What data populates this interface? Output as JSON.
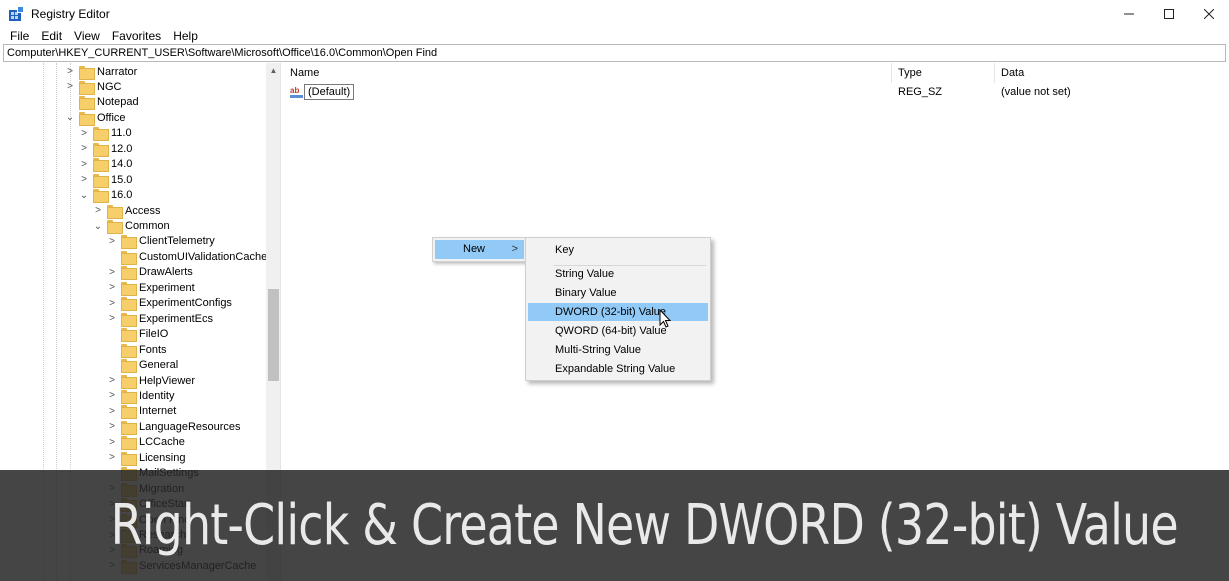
{
  "window": {
    "title": "Registry Editor",
    "minimize_icon": "minimize-icon",
    "maximize_icon": "maximize-icon",
    "close_icon": "close-icon"
  },
  "menu": [
    "File",
    "Edit",
    "View",
    "Favorites",
    "Help"
  ],
  "address": "Computer\\HKEY_CURRENT_USER\\Software\\Microsoft\\Office\\16.0\\Common\\Open Find",
  "tree": [
    {
      "label": "Narrator",
      "chevron": ">"
    },
    {
      "label": "NGC",
      "chevron": ">"
    },
    {
      "label": "Notepad",
      "chevron": ""
    },
    {
      "label": "Office",
      "chevron": "v"
    },
    {
      "label": "11.0",
      "chevron": ">"
    },
    {
      "label": "12.0",
      "chevron": ">"
    },
    {
      "label": "14.0",
      "chevron": ">"
    },
    {
      "label": "15.0",
      "chevron": ">"
    },
    {
      "label": "16.0",
      "chevron": "v"
    },
    {
      "label": "Access",
      "chevron": ">"
    },
    {
      "label": "Common",
      "chevron": "v"
    },
    {
      "label": "ClientTelemetry",
      "chevron": ">"
    },
    {
      "label": "CustomUIValidationCache",
      "chevron": ""
    },
    {
      "label": "DrawAlerts",
      "chevron": ">"
    },
    {
      "label": "Experiment",
      "chevron": ">"
    },
    {
      "label": "ExperimentConfigs",
      "chevron": ">"
    },
    {
      "label": "ExperimentEcs",
      "chevron": ">"
    },
    {
      "label": "FileIO",
      "chevron": ""
    },
    {
      "label": "Fonts",
      "chevron": ""
    },
    {
      "label": "General",
      "chevron": ""
    },
    {
      "label": "HelpViewer",
      "chevron": ">"
    },
    {
      "label": "Identity",
      "chevron": ">"
    },
    {
      "label": "Internet",
      "chevron": ">"
    },
    {
      "label": "LanguageResources",
      "chevron": ">"
    },
    {
      "label": "LCCache",
      "chevron": ">"
    },
    {
      "label": "Licensing",
      "chevron": ">"
    },
    {
      "label": "MailSettings",
      "chevron": ""
    },
    {
      "label": "Migration",
      "chevron": ">"
    },
    {
      "label": "OfficeStart",
      "chevron": ">"
    },
    {
      "label": "Open Find",
      "chevron": ">"
    },
    {
      "label": "Research",
      "chevron": ">"
    },
    {
      "label": "Roaming",
      "chevron": ">"
    },
    {
      "label": "ServicesManagerCache",
      "chevron": ">"
    }
  ],
  "columns": {
    "name": "Name",
    "type": "Type",
    "data": "Data"
  },
  "values": [
    {
      "name": "(Default)",
      "type": "REG_SZ",
      "data": "(value not set)"
    }
  ],
  "context_menu": {
    "new_label": "New",
    "new_arrow": ">",
    "submenu": [
      {
        "label": "Key",
        "highlighted": false
      },
      {
        "label": "String Value",
        "highlighted": false
      },
      {
        "label": "Binary Value",
        "highlighted": false
      },
      {
        "label": "DWORD (32-bit) Value",
        "highlighted": true
      },
      {
        "label": "QWORD (64-bit) Value",
        "highlighted": false
      },
      {
        "label": "Multi-String Value",
        "highlighted": false
      },
      {
        "label": "Expandable String Value",
        "highlighted": false
      }
    ]
  },
  "caption": "Right-Click & Create New DWORD (32-bit) Value",
  "colors": {
    "highlight": "#91c9f7",
    "folder": "#f7cf6a",
    "caption_band": "#262626",
    "caption_text": "#e9e9e9"
  }
}
